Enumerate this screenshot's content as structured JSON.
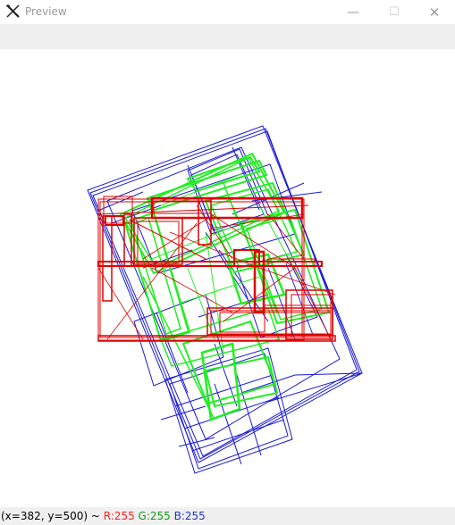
{
  "window": {
    "title": "Preview",
    "minimize_glyph": "—",
    "maximize_glyph": "☐",
    "close_glyph": "✕"
  },
  "status": {
    "coords": "(x=382, y=500) ~ ",
    "r": "R:255",
    "g": "G:255",
    "b": "B:255"
  },
  "colors": {
    "blue_lines": "#1a1ad4",
    "red_lines": "#e00000",
    "green_lines": "#22ee22"
  },
  "icons": {
    "app": "opencv-x-icon"
  }
}
